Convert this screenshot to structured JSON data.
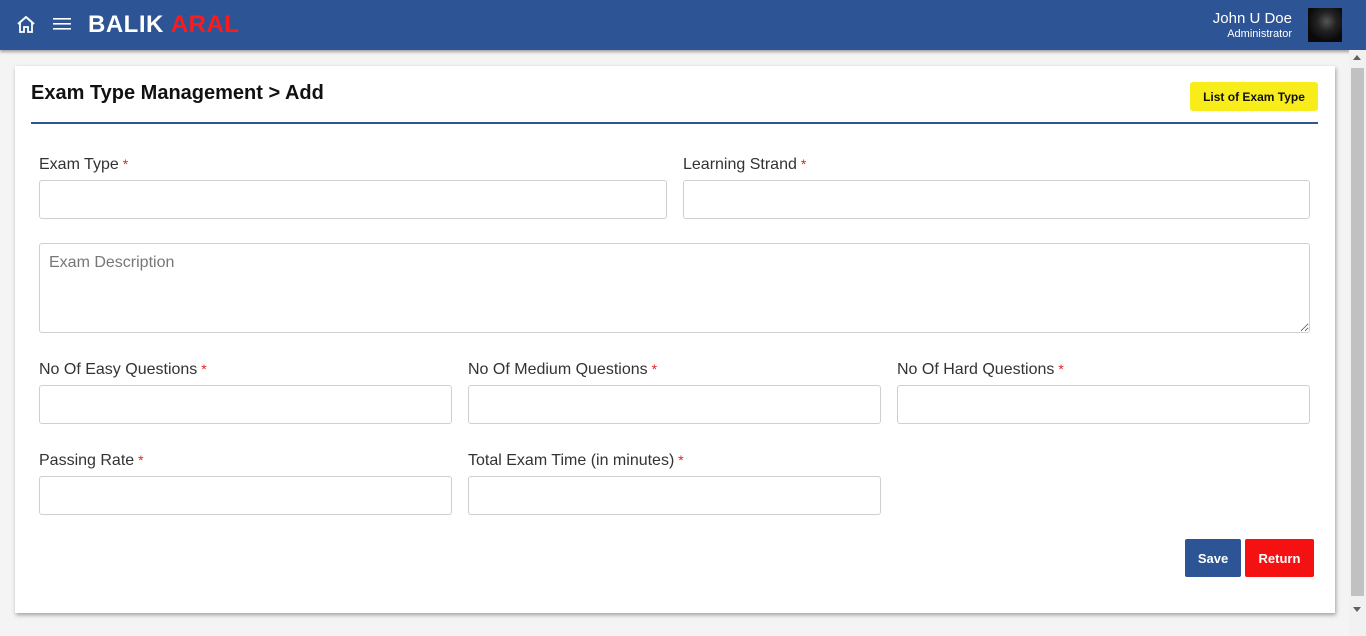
{
  "header": {
    "brand_part1": "BALIK",
    "brand_part2": "ARAL",
    "user_name": "John U Doe",
    "user_role": "Administrator",
    "icons": {
      "home": "home-icon",
      "menu": "hamburger-menu-icon"
    },
    "colors": {
      "bar": "#2d5596",
      "brand_accent": "#ff1a1a"
    }
  },
  "page": {
    "title": "Exam Type Management > Add",
    "list_button": "List of Exam Type"
  },
  "form": {
    "required_mark": "*",
    "exam_type": {
      "label": "Exam Type",
      "value": ""
    },
    "learning_strand": {
      "label": "Learning Strand",
      "value": ""
    },
    "exam_description": {
      "placeholder": "Exam Description",
      "value": ""
    },
    "easy_questions": {
      "label": "No Of Easy Questions",
      "value": ""
    },
    "medium_questions": {
      "label": "No Of Medium Questions",
      "value": ""
    },
    "hard_questions": {
      "label": "No Of Hard Questions",
      "value": ""
    },
    "passing_rate": {
      "label": "Passing Rate",
      "value": ""
    },
    "total_exam_time": {
      "label": "Total Exam Time (in minutes)",
      "value": ""
    }
  },
  "actions": {
    "save": "Save",
    "return": "Return",
    "colors": {
      "save": "#2d5596",
      "return": "#f51111",
      "list": "#f8ec1a"
    }
  }
}
